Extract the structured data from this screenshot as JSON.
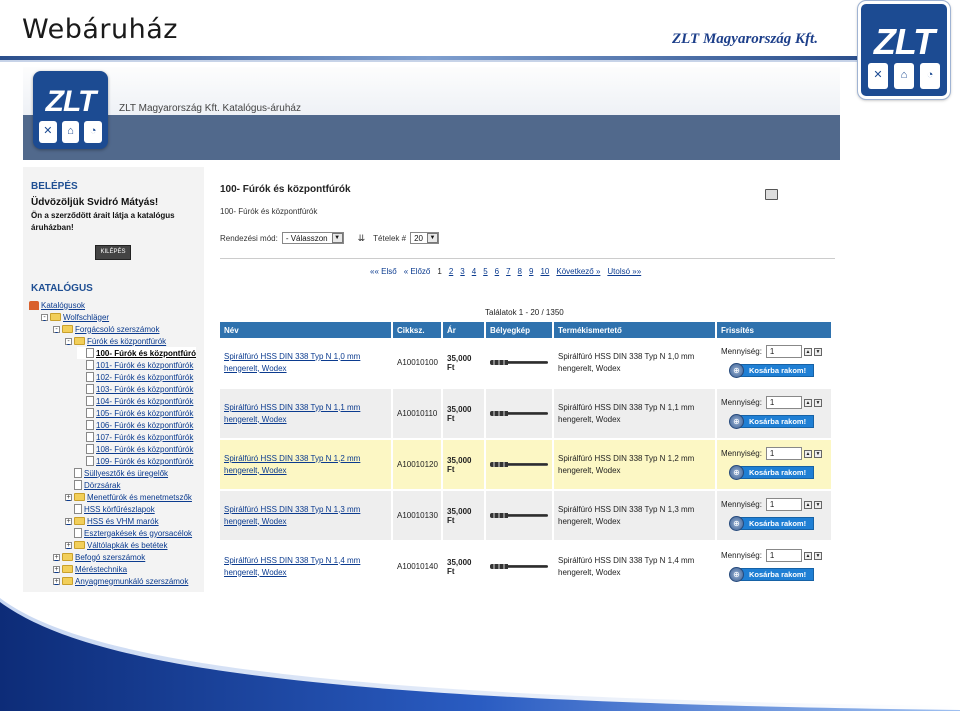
{
  "slide": {
    "title": "Webáruház",
    "company": "ZLT Magyarország Kft.",
    "logo_text": "ZLT"
  },
  "site": {
    "logo_text": "ZLT",
    "title": "ZLT Magyarország Kft. Katalógus-áruház"
  },
  "sidebar": {
    "login_heading": "BELÉPÉS",
    "welcome": "Üdvözöljük Svidró Mátyás!",
    "notice": "Ön a szerződött árait látja a katalógus áruházban!",
    "login_button": "KILÉPÉS",
    "catalog_heading": "KATALÓGUS",
    "tree": [
      {
        "label": "Katalógusok",
        "depth": 0,
        "icon": "home"
      },
      {
        "label": "Wolfschläger",
        "depth": 1,
        "icon": "folder",
        "toggle": "-"
      },
      {
        "label": "Forgácsoló szerszámok",
        "depth": 2,
        "icon": "folder",
        "toggle": "-"
      },
      {
        "label": "Fúrók és központfúrók",
        "depth": 3,
        "icon": "folder",
        "toggle": "-"
      },
      {
        "label": "100- Fúrók és központfúró",
        "depth": 4,
        "icon": "doc",
        "active": true
      },
      {
        "label": "101- Fúrók és központfúrók",
        "depth": 4,
        "icon": "doc"
      },
      {
        "label": "102- Fúrók és központfúrók",
        "depth": 4,
        "icon": "doc"
      },
      {
        "label": "103- Fúrók és központfúrók",
        "depth": 4,
        "icon": "doc"
      },
      {
        "label": "104- Fúrók és központfúrók",
        "depth": 4,
        "icon": "doc"
      },
      {
        "label": "105- Fúrók és központfúrók",
        "depth": 4,
        "icon": "doc"
      },
      {
        "label": "106- Fúrók és központfúrók",
        "depth": 4,
        "icon": "doc"
      },
      {
        "label": "107- Fúrók és központfúrók",
        "depth": 4,
        "icon": "doc"
      },
      {
        "label": "108- Fúrók és központfúrók",
        "depth": 4,
        "icon": "doc"
      },
      {
        "label": "109- Fúrók és központfúrók",
        "depth": 4,
        "icon": "doc"
      },
      {
        "label": "Süllyesztők és üregelők",
        "depth": 3,
        "icon": "doc"
      },
      {
        "label": "Dörzsárak",
        "depth": 3,
        "icon": "doc"
      },
      {
        "label": "Menetfúrók és menetmetszők",
        "depth": 3,
        "icon": "folder",
        "toggle": "+"
      },
      {
        "label": "HSS körfűrészlapok",
        "depth": 3,
        "icon": "doc"
      },
      {
        "label": "HSS és VHM marók",
        "depth": 3,
        "icon": "folder",
        "toggle": "+"
      },
      {
        "label": "Esztergakések és gyorsacélok",
        "depth": 3,
        "icon": "doc"
      },
      {
        "label": "Váltólapkák és betétek",
        "depth": 3,
        "icon": "folder",
        "toggle": "+"
      },
      {
        "label": "Befogó szerszámok",
        "depth": 2,
        "icon": "folder",
        "toggle": "+"
      },
      {
        "label": "Méréstechnika",
        "depth": 2,
        "icon": "folder",
        "toggle": "+"
      },
      {
        "label": "Anyagmegmunkáló szerszámok",
        "depth": 2,
        "icon": "folder",
        "toggle": "+"
      }
    ]
  },
  "main": {
    "title": "100- Fúrók és központfúrók",
    "breadcrumb": "100- Fúrók és központfúrók",
    "sort_label": "Rendezési mód:",
    "sort_value": "- Válasszon",
    "items_label": "Tételek #",
    "items_value": "20",
    "pager": {
      "first": "«« Első",
      "prev": "« Előző",
      "pages": [
        "1",
        "2",
        "3",
        "4",
        "5",
        "6",
        "7",
        "8",
        "9",
        "10"
      ],
      "current": "1",
      "next": "Következő »",
      "last": "Utolsó »»"
    },
    "results": "Találatok 1 - 20 / 1350",
    "columns": [
      "Név",
      "Cikksz.",
      "Ár",
      "Bélyegkép",
      "Termékismertető",
      "Frissítés"
    ],
    "qty_label": "Mennyiség:",
    "cart_label": "Kosárba rakom!",
    "rows": [
      {
        "name": "Spirálfúró HSS DIN 338 Typ N 1,0 mm hengerelt, Wodex",
        "sku": "A10010100",
        "price": "35,000 Ft",
        "desc": "Spirálfúró HSS DIN 338 Typ N 1,0 mm hengerelt, Wodex",
        "qty": "1"
      },
      {
        "name": "Spirálfúró HSS DIN 338 Typ N 1,1 mm hengerelt, Wodex",
        "sku": "A10010110",
        "price": "35,000 Ft",
        "desc": "Spirálfúró HSS DIN 338 Typ N 1,1 mm hengerelt, Wodex",
        "qty": "1"
      },
      {
        "name": "Spirálfúró HSS DIN 338 Typ N 1,2 mm hengerelt, Wodex",
        "sku": "A10010120",
        "price": "35,000 Ft",
        "desc": "Spirálfúró HSS DIN 338 Typ N 1,2 mm hengerelt, Wodex",
        "qty": "1"
      },
      {
        "name": "Spirálfúró HSS DIN 338 Typ N 1,3 mm hengerelt, Wodex",
        "sku": "A10010130",
        "price": "35,000 Ft",
        "desc": "Spirálfúró HSS DIN 338 Typ N 1,3 mm hengerelt, Wodex",
        "qty": "1"
      },
      {
        "name": "Spirálfúró HSS DIN 338 Typ N 1,4 mm hengerelt, Wodex",
        "sku": "A10010140",
        "price": "35,000 Ft",
        "desc": "Spirálfúró HSS DIN 338 Typ N 1,4 mm hengerelt, Wodex",
        "qty": "1"
      }
    ]
  },
  "colors": {
    "brand_blue": "#1c4b92",
    "header_band": "#51698c",
    "table_header": "#2f72ae",
    "highlight_row": "#fcf7c4",
    "cart_button": "#1f7fd4"
  }
}
